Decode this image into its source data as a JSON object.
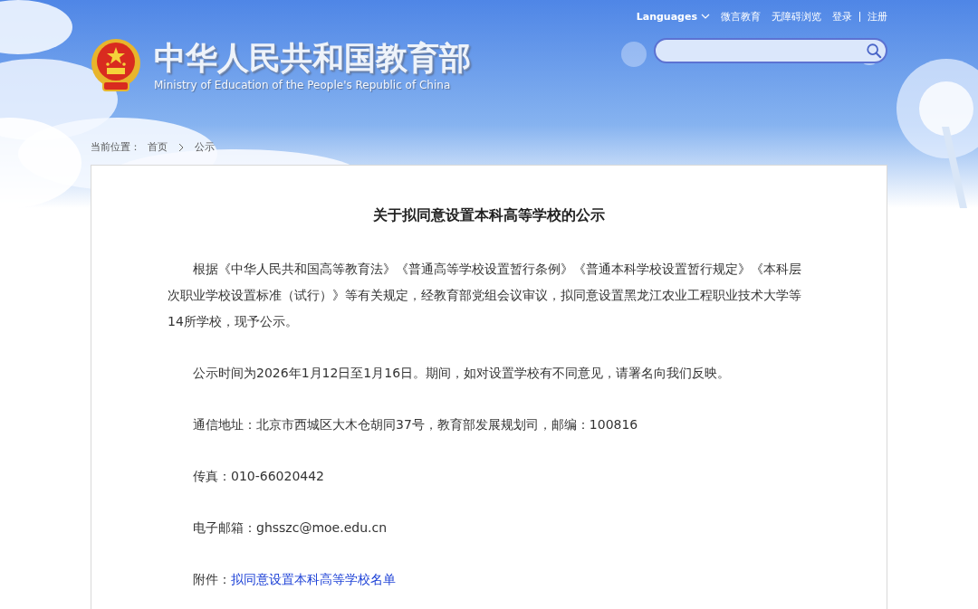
{
  "top_links": [
    {
      "label": "Languages",
      "kind": "dropdown"
    },
    {
      "label": "微言教育",
      "kind": "link"
    },
    {
      "label": "无障碍浏览",
      "kind": "link"
    },
    {
      "label": "登录",
      "kind": "link"
    },
    {
      "label": "注册",
      "kind": "divided_link"
    }
  ],
  "site": {
    "title": "中华人民共和国教育部",
    "subtitle": "Ministry of Education of the People's Republic of China"
  },
  "breadcrumb": {
    "label": "当前位置：",
    "items": [
      "首页",
      "公示"
    ]
  },
  "article": {
    "title": "关于拟同意设置本科高等学校的公示",
    "paragraphs": [
      {
        "kind": "text",
        "text": "根据《中华人民共和国高等教育法》《普通高等学校设置暂行条例》《普通本科学校设置暂行规定》《本科层次职业学校设置标准（试行）》等有关规定，经教育部党组会议审议，拟同意设置黑龙江农业工程职业技术大学等14所学校，现予公示。"
      },
      {
        "kind": "text",
        "text": "公示时间为2026年1月12日至1月16日。期间，如对设置学校有不同意见，请署名向我们反映。"
      },
      {
        "kind": "text",
        "text": "通信地址：北京市西城区大木仓胡同37号，教育部发展规划司，邮编：100816"
      },
      {
        "kind": "text",
        "text": "传真：010-66020442"
      },
      {
        "kind": "text",
        "text": "电子邮箱：ghsszc@moe.edu.cn"
      },
      {
        "kind": "attachment",
        "label": "附件：",
        "link": "拟同意设置本科高等学校名单"
      }
    ]
  }
}
